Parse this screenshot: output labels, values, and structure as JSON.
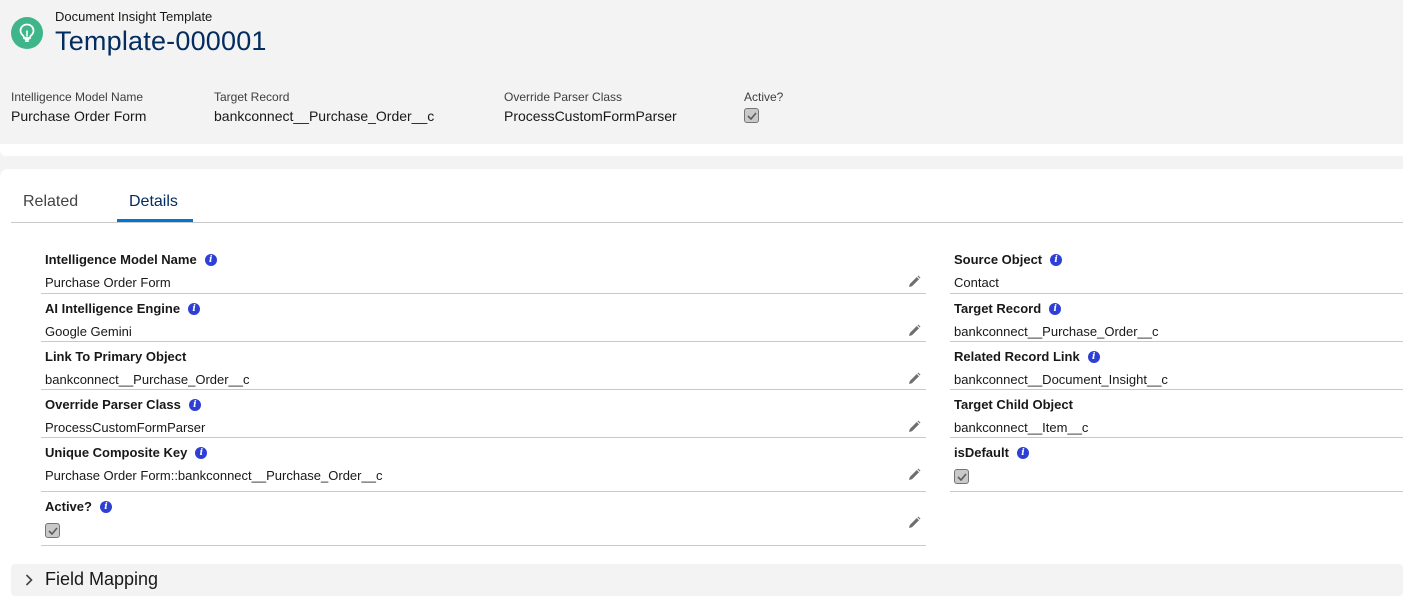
{
  "header": {
    "object_label": "Document Insight Template",
    "title": "Template-000001",
    "icon": "lightbulb-icon",
    "icon_color": "#3fb58a",
    "highlights": [
      {
        "label": "Intelligence Model Name",
        "value": "Purchase Order Form"
      },
      {
        "label": "Target Record",
        "value": "bankconnect__Purchase_Order__c"
      },
      {
        "label": "Override Parser Class",
        "value": "ProcessCustomFormParser"
      },
      {
        "label": "Active?",
        "checked": true
      }
    ]
  },
  "tabs": [
    {
      "label": "Related",
      "active": false
    },
    {
      "label": "Details",
      "active": true
    }
  ],
  "details": {
    "left": [
      {
        "label": "Intelligence Model Name",
        "value": "Purchase Order Form",
        "info": true,
        "editable": true
      },
      {
        "label": "AI Intelligence Engine",
        "value": "Google Gemini",
        "info": true,
        "editable": true
      },
      {
        "label": "Link To Primary Object",
        "value": "bankconnect__Purchase_Order__c",
        "info": false,
        "editable": true
      },
      {
        "label": "Override Parser Class",
        "value": "ProcessCustomFormParser",
        "info": true,
        "editable": true
      },
      {
        "label": "Unique Composite Key",
        "value": "Purchase Order Form::bankconnect__Purchase_Order__c",
        "info": true,
        "editable": true
      },
      {
        "label": "Active?",
        "checked": true,
        "info": true,
        "editable": true
      }
    ],
    "right": [
      {
        "label": "Source Object",
        "value": "Contact",
        "info": true
      },
      {
        "label": "Target Record",
        "value": "bankconnect__Purchase_Order__c",
        "info": true
      },
      {
        "label": "Related Record Link",
        "value": "bankconnect__Document_Insight__c",
        "info": true
      },
      {
        "label": "Target Child Object",
        "value": "bankconnect__Item__c",
        "info": false
      },
      {
        "label": "isDefault",
        "checked": true,
        "info": true
      }
    ]
  },
  "sections": [
    {
      "title": "Field Mapping",
      "expanded": false
    }
  ],
  "colors": {
    "accent": "#0176d3",
    "title": "#032d60",
    "info": "#2e3fd6"
  }
}
